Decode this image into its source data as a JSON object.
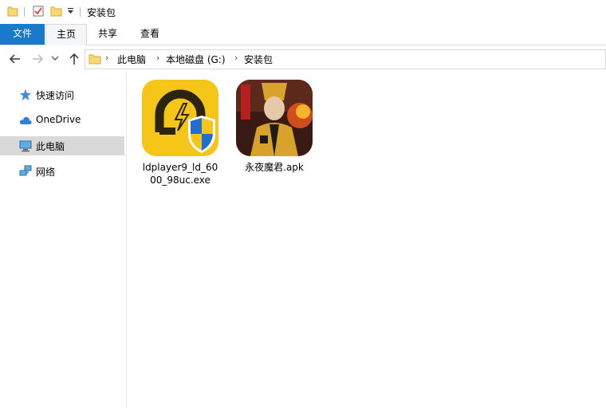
{
  "window": {
    "title": "安装包"
  },
  "ribbon": {
    "tabs": [
      "文件",
      "主页",
      "共享",
      "查看"
    ]
  },
  "address": {
    "crumbs": [
      "此电脑",
      "本地磁盘 (G:)",
      "安装包"
    ]
  },
  "nav": {
    "items": [
      {
        "label": "快速访问",
        "icon": "star-icon"
      },
      {
        "label": "OneDrive",
        "icon": "cloud-icon"
      },
      {
        "label": "此电脑",
        "icon": "computer-icon",
        "selected": true
      },
      {
        "label": "网络",
        "icon": "network-icon"
      }
    ]
  },
  "files": [
    {
      "name": "ldplayer9_ld_6000_98uc.exe",
      "icon": "ldplayer-app-icon"
    },
    {
      "name": "永夜魔君.apk",
      "icon": "game-app-icon"
    }
  ],
  "colors": {
    "accent": "#1979ca",
    "selection": "#d9d9d9",
    "ld_yellow": "#f5c518"
  }
}
